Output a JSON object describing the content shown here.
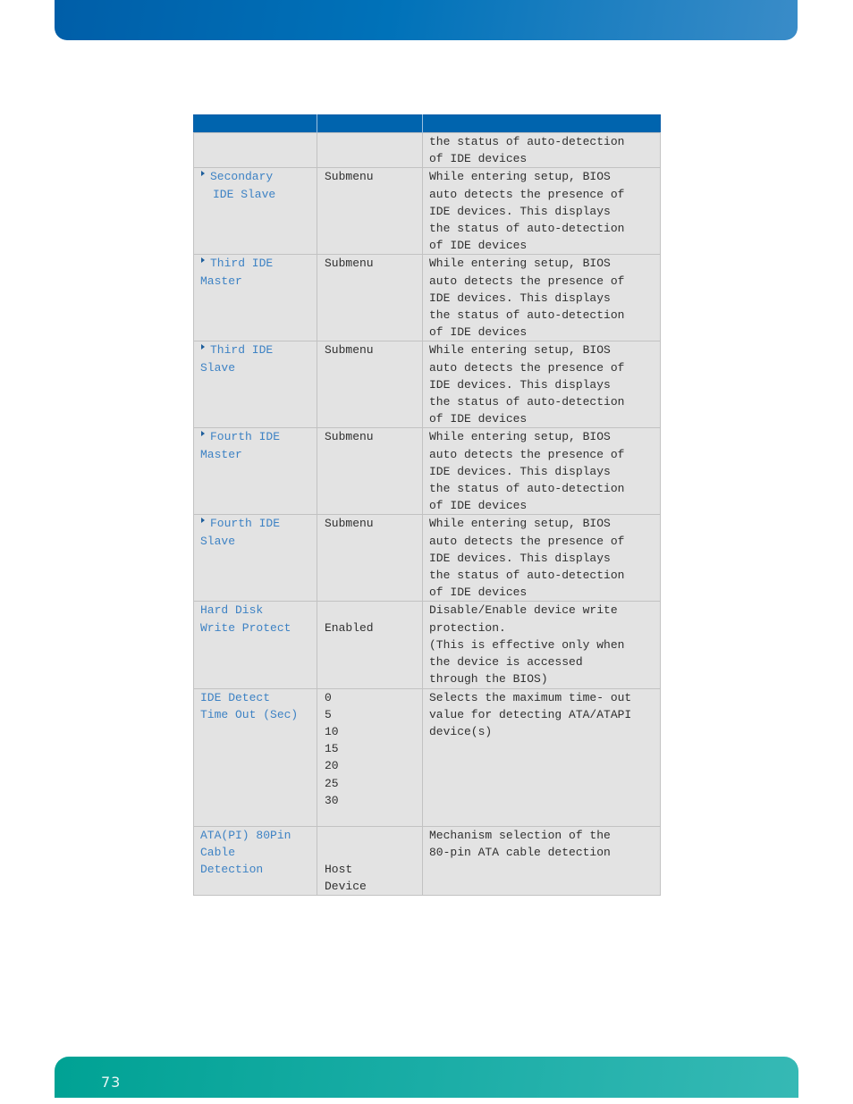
{
  "page": {
    "number": "73"
  },
  "table": {
    "header": [
      "",
      "",
      ""
    ],
    "rows": [
      {
        "label_lines": [],
        "has_arrow": false,
        "values": [],
        "description": "the status of auto-detection\nof IDE devices"
      },
      {
        "label_lines": [
          "Secondary",
          "IDE Slave"
        ],
        "has_arrow": true,
        "values": [
          "Submenu"
        ],
        "description": "While entering setup, BIOS\nauto detects the presence of\nIDE devices. This displays\nthe status of auto-detection\nof IDE devices"
      },
      {
        "label_lines": [
          "Third IDE",
          "Master"
        ],
        "has_arrow": true,
        "values": [
          "Submenu"
        ],
        "description": "While entering setup, BIOS\nauto detects the presence of\nIDE devices. This displays\nthe status of auto-detection\nof IDE devices"
      },
      {
        "label_lines": [
          "Third IDE",
          "Slave"
        ],
        "has_arrow": true,
        "values": [
          "Submenu"
        ],
        "description": "While entering setup, BIOS\nauto detects the presence of\nIDE devices. This displays\nthe status of auto-detection\nof IDE devices"
      },
      {
        "label_lines": [
          "Fourth IDE",
          "Master"
        ],
        "has_arrow": true,
        "values": [
          "Submenu"
        ],
        "description": "While entering setup, BIOS\nauto detects the presence of\nIDE devices. This displays\nthe status of auto-detection\nof IDE devices"
      },
      {
        "label_lines": [
          "Fourth IDE",
          "Slave"
        ],
        "has_arrow": true,
        "values": [
          "Submenu"
        ],
        "description": "While entering setup, BIOS\nauto detects the presence of\nIDE devices. This displays\nthe status of auto-detection\nof IDE devices"
      },
      {
        "label_lines": [
          "Hard Disk",
          "Write Protect"
        ],
        "has_arrow": false,
        "values": [
          "",
          "Enabled"
        ],
        "description": "Disable/Enable device write\nprotection.\n(This is effective only when\nthe device is accessed\nthrough the BIOS)"
      },
      {
        "label_lines": [
          "IDE Detect",
          "Time Out (Sec)"
        ],
        "has_arrow": false,
        "values": [
          "0",
          "5",
          "10",
          "15",
          "20",
          "25",
          "30"
        ],
        "description": "Selects the maximum time- out\nvalue for detecting ATA/ATAPI\ndevice(s)"
      },
      {
        "label_lines": [
          "ATA(PI) 80Pin",
          "Cable",
          "Detection"
        ],
        "has_arrow": false,
        "values": [
          "",
          "",
          "Host",
          "Device"
        ],
        "description": "Mechanism selection of the\n80-pin ATA cable detection"
      }
    ]
  }
}
